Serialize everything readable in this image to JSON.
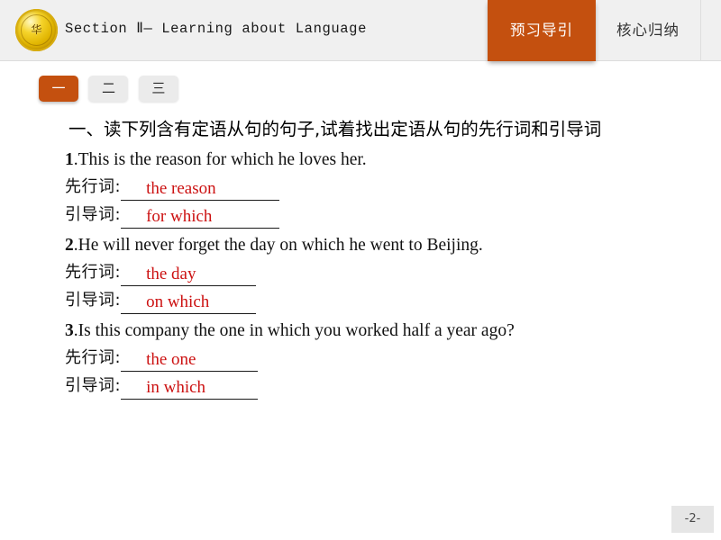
{
  "header": {
    "logo_icon": "gold-seal-logo-icon",
    "logo_glyph": "华",
    "title": "Section Ⅱ— Learning about Language",
    "tabs": [
      {
        "label": "预习导引",
        "active": true
      },
      {
        "label": "核心归纳",
        "active": false
      }
    ],
    "accent_color": "#c4500f",
    "bg_color": "#f0f0f0"
  },
  "subtabs": [
    {
      "label": "一",
      "active": true
    },
    {
      "label": "二",
      "active": false
    },
    {
      "label": "三",
      "active": false
    }
  ],
  "content": {
    "heading": "一、读下列含有定语从句的句子,试着找出定语从句的先行词和引导词",
    "answer_color": "#cc1111",
    "labels": {
      "antecedent": "先行词:",
      "relative": "引导词:"
    },
    "questions": [
      {
        "number": "1",
        "sentence": ".This is the reason for which he loves her.",
        "antecedent": "the reason",
        "relative": "for which"
      },
      {
        "number": "2",
        "sentence": ".He will never forget the day on which he went to Beijing.",
        "antecedent": "the day",
        "relative": "on which"
      },
      {
        "number": "3",
        "sentence": ".Is this company the one in which you worked half a year ago?",
        "antecedent": "the one",
        "relative": "in which"
      }
    ]
  },
  "footer": {
    "page_number": "-2-"
  }
}
